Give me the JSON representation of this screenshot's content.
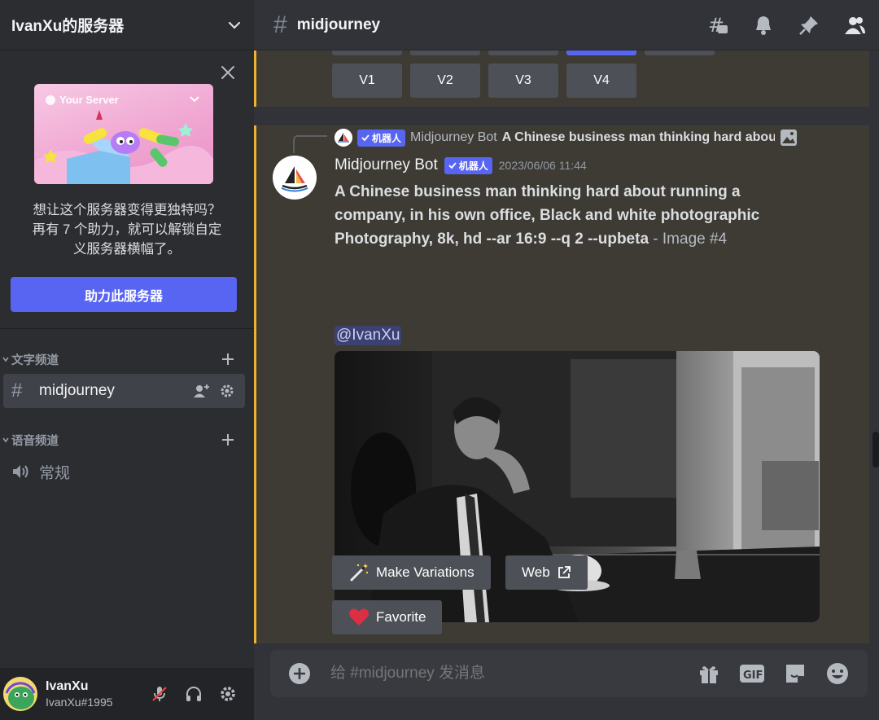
{
  "server": {
    "name": "IvanXu的服务器"
  },
  "boost": {
    "banner_title": "Your Server",
    "text_line1": "想让这个服务器变得更独特吗？",
    "text_line2": "再有 7 个助力，就可以解锁自定",
    "text_line3": "义服务器横幅了。",
    "button_label": "助力此服务器"
  },
  "categories": {
    "text": "文字频道",
    "voice": "语音频道"
  },
  "channels": {
    "text_channel": "midjourney",
    "voice_channel": "常规"
  },
  "user": {
    "name": "IvanXu",
    "tag": "IvanXu#1995"
  },
  "topbar": {
    "channel_name": "midjourney"
  },
  "variation_buttons": [
    "V1",
    "V2",
    "V3",
    "V4"
  ],
  "message": {
    "reply_author": "Midjourney Bot",
    "reply_preview": "A Chinese business man thinking hard about running a company",
    "bot_badge": "机器人",
    "author": "Midjourney Bot",
    "timestamp": "2023/06/06 11:44",
    "prompt_line1": "A Chinese business man thinking hard about running a",
    "prompt_line2": "company, in his own office, Black and white photographic",
    "prompt_line3": "Photography, 8k, hd --ar 16:9 --q 2 --upbeta",
    "prompt_suffix": " - Image #4",
    "mention": "@IvanXu"
  },
  "actions": {
    "make_variations": "Make Variations",
    "web": "Web",
    "favorite": "Favorite"
  },
  "composer": {
    "placeholder": "给 #midjourney 发消息"
  },
  "colors": {
    "accent": "#5865f2",
    "highlight_bar": "#f0b232",
    "highlight_bg": "#3d3b34",
    "sidebar_bg": "#2b2d31",
    "main_bg": "#313338"
  }
}
